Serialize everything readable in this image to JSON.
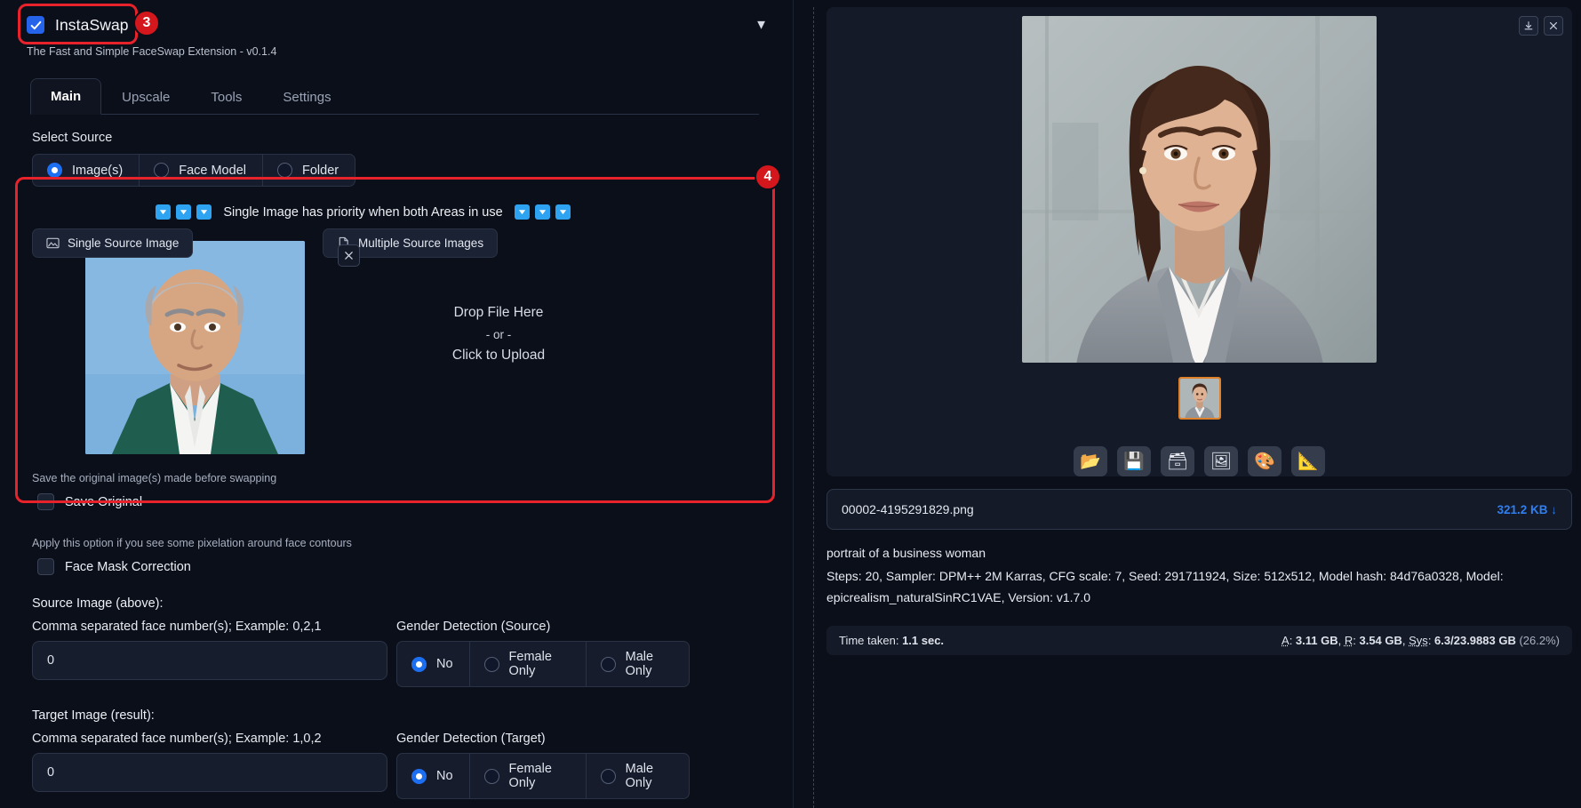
{
  "extension": {
    "title": "InstaSwap",
    "subtitle": "The Fast and Simple FaceSwap Extension - v0.1.4",
    "enabled_checkbox": "checked",
    "collapse_icon": "chevron-down-icon"
  },
  "tabs": [
    {
      "label": "Main",
      "active": true
    },
    {
      "label": "Upscale",
      "active": false
    },
    {
      "label": "Tools",
      "active": false
    },
    {
      "label": "Settings",
      "active": false
    }
  ],
  "select_source": {
    "label": "Select Source",
    "options": [
      {
        "label": "Image(s)",
        "selected": true
      },
      {
        "label": "Face Model",
        "selected": false
      },
      {
        "label": "Folder",
        "selected": false
      }
    ]
  },
  "source_area": {
    "priority_text": "Single Image has priority when both Areas in use",
    "arrow_icon": "triangle-down-icon",
    "left_arrows": 3,
    "right_arrows": 3,
    "single_tab": "Single Source Image",
    "single_tab_icon": "image-icon",
    "multiple_tab": "Multiple Source Images",
    "multiple_tab_icon": "file-icon",
    "clear_icon": "close-icon",
    "drop_line1": "Drop File Here",
    "drop_line2": "- or -",
    "drop_line3": "Click to Upload"
  },
  "options": {
    "save_original_helper": "Save the original image(s) made before swapping",
    "save_original_label": "Save Original",
    "save_original_checked": false,
    "face_mask_helper": "Apply this option if you see some pixelation around face contours",
    "face_mask_label": "Face Mask Correction",
    "face_mask_checked": false
  },
  "source_image": {
    "title": "Source Image (above):",
    "face_numbers_label": "Comma separated face number(s); Example: 0,2,1",
    "face_numbers_value": "0",
    "gender_label": "Gender Detection (Source)",
    "gender_options": [
      {
        "label": "No",
        "selected": true
      },
      {
        "label": "Female Only",
        "selected": false
      },
      {
        "label": "Male Only",
        "selected": false
      }
    ]
  },
  "target_image": {
    "title": "Target Image (result):",
    "face_numbers_label": "Comma separated face number(s); Example: 1,0,2",
    "face_numbers_value": "0",
    "gender_label": "Gender Detection (Target)",
    "gender_options": [
      {
        "label": "No",
        "selected": true
      },
      {
        "label": "Female Only",
        "selected": false
      },
      {
        "label": "Male Only",
        "selected": false
      }
    ]
  },
  "annotations": [
    {
      "number": "3",
      "target": "instaswap-header"
    },
    {
      "number": "4",
      "target": "source-image-area"
    }
  ],
  "result_panel": {
    "download_icon": "download-icon",
    "close_icon": "close-icon",
    "action_icons": [
      {
        "name": "open-folder-icon",
        "glyph": "📂"
      },
      {
        "name": "save-floppy-icon",
        "glyph": "💾"
      },
      {
        "name": "card-file-box-icon",
        "glyph": "🗃"
      },
      {
        "name": "framed-picture-icon",
        "glyph": "🖼"
      },
      {
        "name": "artist-palette-icon",
        "glyph": "🎨"
      },
      {
        "name": "triangular-ruler-icon",
        "glyph": "📐"
      }
    ],
    "file_name": "00002-4195291829.png",
    "file_size": "321.2 KB",
    "file_size_icon": "download-arrow-icon",
    "prompt": "portrait of a business woman",
    "params_line_1": "Steps: 20, Sampler: DPM++ 2M Karras, CFG scale: 7, Seed: 291711924, Size: 512x512, Model hash: 84d76a0328, Model:",
    "params_line_2": "epicrealism_naturalSinRC1VAE, Version: v1.7.0",
    "time_taken_label": "Time taken:",
    "time_taken_value": "1.1 sec.",
    "mem_a_label": "A",
    "mem_a_value": "3.11 GB",
    "mem_r_label": "R",
    "mem_r_value": "3.54 GB",
    "mem_sys_label": "Sys",
    "mem_sys_value": "6.3/23.9883 GB",
    "mem_sys_pct": "(26.2%)"
  },
  "colors": {
    "accent_blue": "#2563eb",
    "link_blue": "#2f7ff0",
    "annotation_red": "#e8222a",
    "panel_bg": "#141a28",
    "page_bg": "#0b0f19",
    "thumb_border": "#e0812a"
  }
}
